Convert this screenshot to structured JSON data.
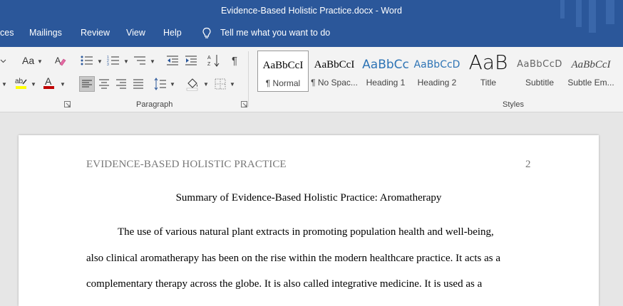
{
  "window": {
    "title": "Evidence-Based Holistic Practice.docx  -  Word"
  },
  "tabs": [
    {
      "label": "ces"
    },
    {
      "label": "Mailings"
    },
    {
      "label": "Review"
    },
    {
      "label": "View"
    },
    {
      "label": "Help"
    }
  ],
  "tellme": {
    "text": "Tell me what you want to do",
    "icon": "lightbulb-icon"
  },
  "ribbon": {
    "font_group": {
      "change_case_label": "Aa"
    },
    "paragraph_group": {
      "label": "Paragraph"
    },
    "styles_group": {
      "label": "Styles",
      "items": [
        {
          "sample": "AaBbCcI",
          "name": "¶ Normal",
          "selected": true
        },
        {
          "sample": "AaBbCcI",
          "name": "¶ No Spac..."
        },
        {
          "sample": "AaBbCc",
          "name": "Heading 1"
        },
        {
          "sample": "AaBbCcD",
          "name": "Heading 2"
        },
        {
          "sample": "AaB",
          "name": "Title"
        },
        {
          "sample": "AaBbCcD",
          "name": "Subtitle"
        },
        {
          "sample": "AaBbCcI",
          "name": "Subtle Em..."
        }
      ]
    }
  },
  "document": {
    "running_head": "EVIDENCE-BASED HOLISTIC PRACTICE",
    "page_number": "2",
    "title": "Summary of Evidence-Based Holistic Practice: Aromatherapy",
    "lines": [
      "The use of various natural plant extracts in promoting population health and well-being,",
      "also clinical aromatherapy has been on the rise within the modern healthcare practice. It acts as a",
      "complementary therapy across the globe. It is also called integrative medicine. It is used as a"
    ]
  },
  "colors": {
    "titlebar": "#2b579a",
    "font_color_red": "#c00000",
    "highlight_yellow": "#ffff00"
  }
}
